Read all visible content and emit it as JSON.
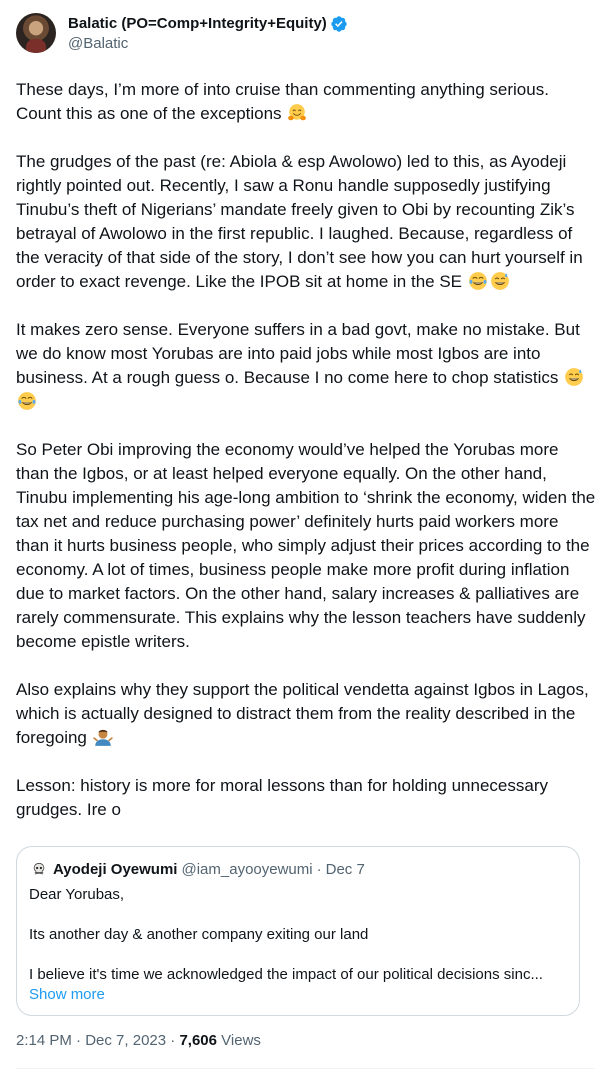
{
  "author": {
    "display_name": "Balatic (PO=Comp+Integrity+Equity)",
    "handle": "@Balatic",
    "verified": true,
    "verified_color": "#1d9bf0"
  },
  "body": {
    "p1_a": "These days, I’m more of into cruise than commenting anything serious. Count this as one of the exceptions",
    "p1_emoji": "hugging-face",
    "p2_a": "The grudges of the past (re: Abiola & esp Awolowo) led to this, as Ayodeji rightly pointed out. Recently, I saw a Ronu handle supposedly justifying Tinubu’s theft of Nigerians’ mandate freely given to Obi by recounting Zik’s betrayal of Awolowo in the first republic. I laughed. Because, regardless of the veracity of that side of the story, I don’t see how you can hurt yourself in order to exact revenge. Like the IPOB sit at home in the SE",
    "p2_emojis": [
      "tears-of-joy",
      "grinning-sweat"
    ],
    "p3_a": "It makes zero sense. Everyone suffers in a bad govt, make no mistake. But we do know most Yorubas are into paid jobs while most Igbos are into business. At a rough guess o. Because I no come here to chop statistics",
    "p3_emojis": [
      "grinning-sweat",
      "tears-of-joy"
    ],
    "p4": "So Peter Obi improving the economy would’ve helped the Yorubas more than the Igbos, or at least helped everyone equally. On the other hand, Tinubu implementing his age-long ambition to ‘shrink the economy, widen the tax net and reduce purchasing power’ definitely hurts paid workers more than it hurts business people, who simply adjust their prices according to the economy. A lot of times, business people make more profit during inflation due to market factors. On the other hand, salary increases & palliatives are rarely commensurate. This explains why the lesson teachers have suddenly become epistle writers.",
    "p5_a": "Also explains why they support the political vendetta against Igbos in Lagos, which is actually designed to distract them from the reality described in the foregoing",
    "p5_emoji": "man-shrugging",
    "p6": "Lesson: history is more for moral lessons than for holding unnecessary grudges. Ire o"
  },
  "quote": {
    "avatar_icon": "skull-icon",
    "name": "Ayodeji Oyewumi",
    "handle": "@iam_ayooyewumi",
    "separator": "·",
    "date": "Dec 7",
    "line1": "Dear Yorubas,",
    "line2": "Its another day & another company exiting our land",
    "line3": "I believe it's time we acknowledged the impact of our political decisions sinc...",
    "show_more": "Show more"
  },
  "footer": {
    "time": "2:14 PM",
    "dot1": "·",
    "date": "Dec 7, 2023",
    "dot2": "·",
    "views_count": "7,606",
    "views_label": "Views"
  }
}
